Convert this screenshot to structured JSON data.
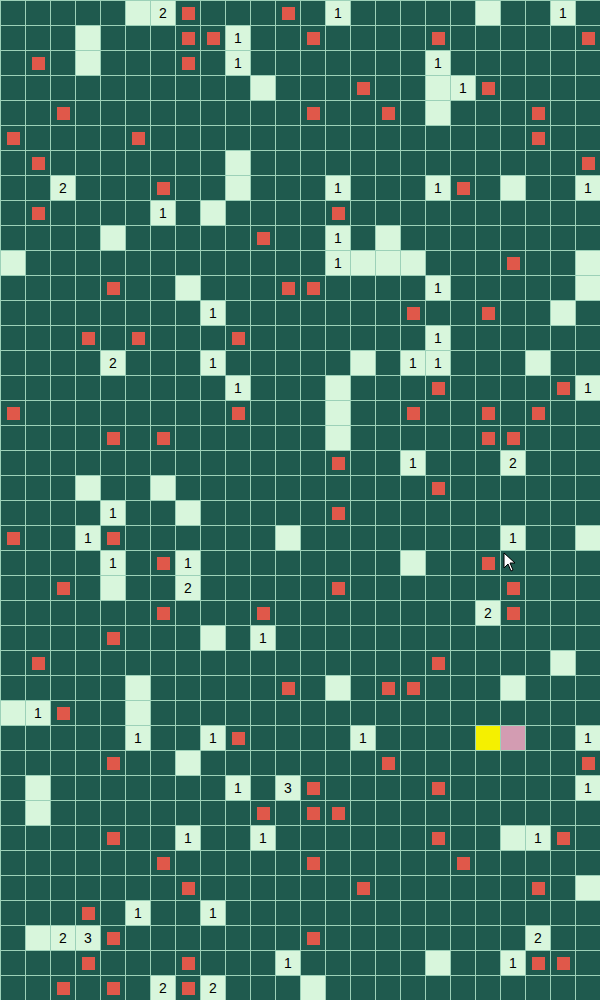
{
  "board": {
    "columns": 24,
    "rows": [
      "....._2F...F.1....._..1.",
      "..._...FF1..F....F.....F",
      ".F._...F.1.......1......",
      ".........._...F.._1F....",
      "..F.........F..F._...F..",
      "F....F...............F..",
      ".F......._.............F",
      "..2...F.._...1...1F._..1",
      ".F....1._....F..........",
      "...._.....F..1._........",
      "_............1___...F.._",
      "....F.._...FF....1....._",
      "........1.......F..F.._.",
      "...F.F...F.......1......",
      "....2...1....._.11..._..",
      ".........1..._...F....F1",
      "F........F..._..F..F.F..",
      "....F.F......_.....FF...",
      ".............F..1...2...",
      "..._.._..........F......",
      "....1.._.....F..........",
      "F..1F......_........1.._",
      "....1.F1........_..F....",
      "..F._..2.....F......F...",
      "......F...F........2F...",
      "....F..._.1.............",
      ".F...............F...._.",
      "....._.....F._.FF..._...",
      "_1F.._..................",
      ".....1..1F....1....YP..1",
      "....F.._.......F.......F",
      "._.......1.3F....F.....1",
      "._........F.FF..........",
      "....F..1..1......F.._1F.",
      "......F.....F.....F.....",
      ".......F......F......F._",
      "...F.1..1...............",
      "._23F.......F........2..",
      "...F...F...1....._..1FF.",
      "..F.F.2F2..._..........."
    ]
  },
  "pointer": {
    "shown": true
  }
}
